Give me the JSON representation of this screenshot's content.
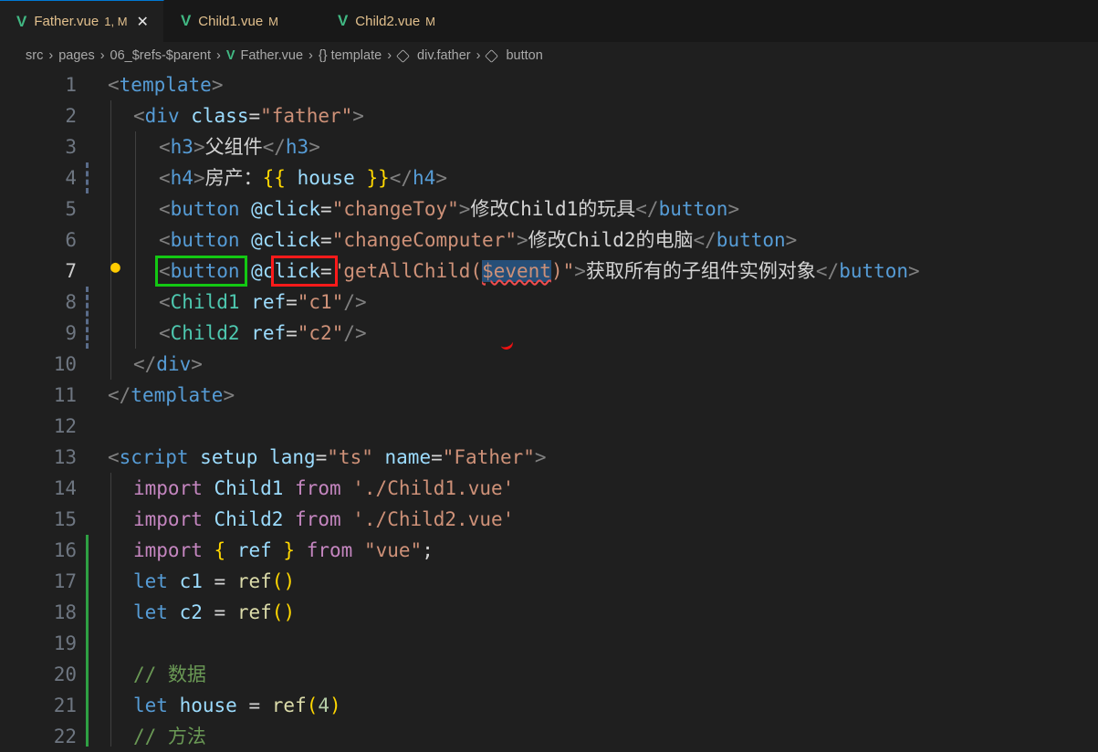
{
  "tabs": [
    {
      "label": "Father.vue",
      "status": "1, M",
      "active": true
    },
    {
      "label": "Child1.vue",
      "status": "M"
    },
    {
      "label": "Child2.vue",
      "status": "M"
    }
  ],
  "tab_icon": "V",
  "close_icon": "✕",
  "breadcrumb": {
    "items": [
      "src",
      "pages",
      "06_$refs-$parent",
      "Father.vue",
      "{} template",
      "div.father",
      "button"
    ]
  },
  "lines": [
    {
      "n": "1"
    },
    {
      "n": "2"
    },
    {
      "n": "3"
    },
    {
      "n": "4"
    },
    {
      "n": "5"
    },
    {
      "n": "6"
    },
    {
      "n": "7"
    },
    {
      "n": "8"
    },
    {
      "n": "9"
    },
    {
      "n": "10"
    },
    {
      "n": "11"
    },
    {
      "n": "12"
    },
    {
      "n": "13"
    },
    {
      "n": "14"
    },
    {
      "n": "15"
    },
    {
      "n": "16"
    },
    {
      "n": "17"
    },
    {
      "n": "18"
    },
    {
      "n": "19"
    },
    {
      "n": "20"
    },
    {
      "n": "21"
    },
    {
      "n": "22"
    }
  ],
  "code": {
    "l1": "template",
    "l2_tag": "div",
    "l2_attr": "class",
    "l2_val": "\"father\"",
    "l3_tag": "h3",
    "l3_text": "父组件",
    "l4_tag": "h4",
    "l4_text": "房产：",
    "l4_var": "house",
    "l5_tag": "button",
    "l5_attr": "@click",
    "l5_val": "\"changeToy\"",
    "l5_text": "修改Child1的玩具",
    "l6_tag": "button",
    "l6_attr": "@click",
    "l6_val": "\"changeComputer\"",
    "l6_text": "修改Child2的电脑",
    "l7_tag": "button",
    "l7_attr_at": "@",
    "l7_attr": "click",
    "l7_val_a": "\"getAllChild(",
    "l7_val_b": "$event",
    "l7_val_c": ")\"",
    "l7_text": "获取所有的子组件实例对象",
    "l8_tag": "Child1",
    "l8_attr": "ref",
    "l8_val": "\"c1\"",
    "l9_tag": "Child2",
    "l9_attr": "ref",
    "l9_val": "\"c2\"",
    "l10_tag": "div",
    "l11_tag": "template",
    "l13_tag": "script",
    "l13_a1": "setup",
    "l13_a2": "lang",
    "l13_v2": "\"ts\"",
    "l13_a3": "name",
    "l13_v3": "\"Father\"",
    "l14_kw": "import",
    "l14_id": "Child1",
    "l14_from": "from",
    "l14_str": "'./Child1.vue'",
    "l15_kw": "import",
    "l15_id": "Child2",
    "l15_from": "from",
    "l15_str": "'./Child2.vue'",
    "l16_kw": "import",
    "l16_id": "ref",
    "l16_from": "from",
    "l16_str": "\"vue\"",
    "l17_kw": "let",
    "l17_id": "c1",
    "l17_fn": "ref",
    "l18_kw": "let",
    "l18_id": "c2",
    "l18_fn": "ref",
    "l20_cmt": "// 数据",
    "l21_kw": "let",
    "l21_id": "house",
    "l21_fn": "ref",
    "l21_num": "4",
    "l22_cmt": "// 方法"
  }
}
